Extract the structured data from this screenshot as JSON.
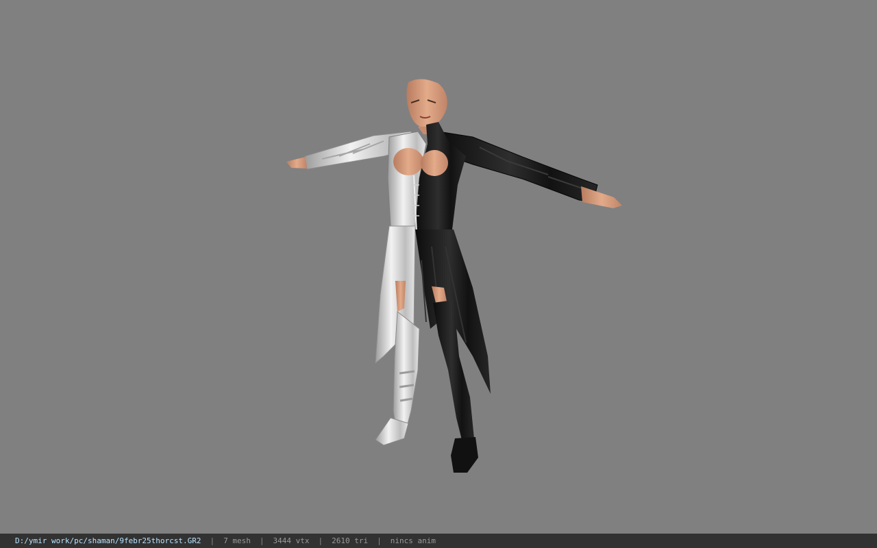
{
  "viewer": {
    "background_color": "#808080",
    "model": {
      "name": "shaman-model",
      "palette": {
        "skin": "#d9a07f",
        "skin_shadow": "#a8705a",
        "black_outfit": "#161616",
        "white_outfit": "#d8d8d8"
      }
    }
  },
  "status": {
    "file_path": "D:/ymir work/pc/shaman/9febr25thorcst.GR2",
    "separator": "|",
    "mesh_count": "7 mesh",
    "vertex_count": "3444 vtx",
    "triangle_count": "2610 tri",
    "animation": "nincs anim"
  }
}
